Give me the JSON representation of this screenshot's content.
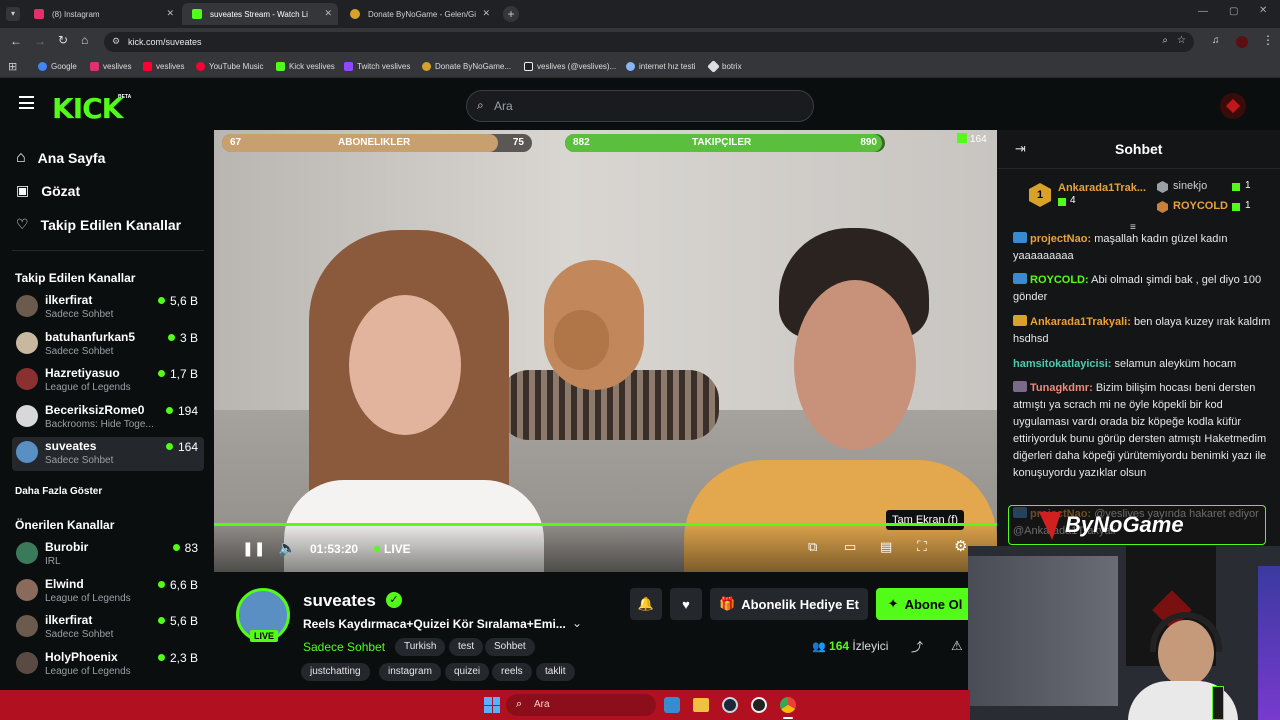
{
  "browser": {
    "tabs": [
      {
        "title": "(8) Instagram",
        "color": "#e1306c"
      },
      {
        "title": "suveates Stream - Watch Li",
        "color": "#53fc18"
      },
      {
        "title": "Donate ByNoGame - Gelen/Gi",
        "color": "#d6a22a"
      }
    ],
    "url": "kick.com/suveates",
    "bookmarks": [
      {
        "label": "Google",
        "color": "#4285f4"
      },
      {
        "label": "veslives",
        "color": "#e1306c"
      },
      {
        "label": "veslives",
        "color": "#ff0033"
      },
      {
        "label": "YouTube Music",
        "color": "#ff0033"
      },
      {
        "label": "Kick veslives",
        "color": "#53fc18"
      },
      {
        "label": "Twitch veslives",
        "color": "#9146ff"
      },
      {
        "label": "Donate ByNoGame...",
        "color": "#d6a22a"
      },
      {
        "label": "veslives (@veslives)...",
        "color": "#ffffff"
      },
      {
        "label": "internet hız testi",
        "color": "#8ab4f8"
      },
      {
        "label": "botrix",
        "color": "#dddddd"
      }
    ]
  },
  "kick": {
    "logo": "KICK",
    "beta": "BETA",
    "search_placeholder": "Ara"
  },
  "nav": {
    "home": "Ana Sayfa",
    "browse": "Gözat",
    "following": "Takip Edilen Kanallar"
  },
  "followed": {
    "heading": "Takip Edilen Kanallar",
    "channels": [
      {
        "name": "ilkerfirat",
        "sub": "Sadece Sohbet",
        "viewers": "5,6 B",
        "color": "#6b5a4e"
      },
      {
        "name": "batuhanfurkan5",
        "sub": "Sadece Sohbet",
        "viewers": "3 B",
        "color": "#c9b8a0"
      },
      {
        "name": "Hazretiyasuo",
        "sub": "League of Legends",
        "viewers": "1,7 B",
        "color": "#8a3030"
      },
      {
        "name": "BeceriksizRome0",
        "sub": "Backrooms: Hide Toge...",
        "viewers": "194",
        "color": "#d8d8d8"
      },
      {
        "name": "suveates",
        "sub": "Sadece Sohbet",
        "viewers": "164",
        "color": "#5a8fc4"
      }
    ],
    "more": "Daha Fazla Göster"
  },
  "recommended": {
    "heading": "Önerilen Kanallar",
    "channels": [
      {
        "name": "Burobir",
        "sub": "IRL",
        "viewers": "83",
        "color": "#3a7a5a"
      },
      {
        "name": "Elwind",
        "sub": "League of Legends",
        "viewers": "6,6 B",
        "color": "#8a6a5a"
      },
      {
        "name": "ilkerfirat",
        "sub": "Sadece Sohbet",
        "viewers": "5,6 B",
        "color": "#6b5a4e"
      },
      {
        "name": "HolyPhoenix",
        "sub": "League of Legends",
        "viewers": "2,3 B",
        "color": "#5a4a44"
      }
    ]
  },
  "video": {
    "goal_subs": {
      "label": "ABONELIKLER",
      "current": "67",
      "target": "75",
      "progress": 0.89
    },
    "goal_followers": {
      "label": "TAKIPÇILER",
      "current": "882",
      "target": "890",
      "progress": 0.99
    },
    "viewer_badge": "164",
    "time": "01:53:20",
    "live": "LIVE",
    "tooltip": "Tam Ekran (f)"
  },
  "stream": {
    "channel": "suveates",
    "title": "Reels Kaydırmaca+Quizei Kör Sıralama+Emi...",
    "category": "Sadece Sohbet",
    "tags": [
      "Turkish",
      "test",
      "Sohbet"
    ],
    "tags2": [
      "justchatting",
      "instagram",
      "quizei",
      "reels",
      "taklit"
    ],
    "live_badge": "LIVE",
    "gift_button": "Abonelik Hediye Et",
    "subscribe_button": "Abone Ol",
    "viewers_count": "164",
    "viewers_label": "İzleyici"
  },
  "chat": {
    "title": "Sohbet",
    "top_gifter": {
      "name": "Ankarada1Trak...",
      "count": "4",
      "rank": "1"
    },
    "gifters": [
      {
        "name": "sinekjo",
        "count": "1",
        "color": "#cfcfcf"
      },
      {
        "name": "ROYCOLD",
        "count": "1",
        "color": "#e8a23c"
      }
    ],
    "messages": [
      {
        "user": "projectNao:",
        "text": "maşallah kadın güzel kadın yaaaaaaaaa",
        "color": "#e8a23c"
      },
      {
        "user": "ROYCOLD:",
        "text": "Abi olmadı şimdi bak , gel diyo 100 gönder",
        "color": "#53fc18"
      },
      {
        "user": "Ankarada1Trakyali:",
        "text": "ben olaya kuzey ırak kaldım hsdhsd",
        "color": "#e8a23c"
      },
      {
        "user": "hamsitokatlayicisi:",
        "text": "selamun aleyküm hocam",
        "color": "#4ec9b0"
      },
      {
        "user": "Tunagkdmr:",
        "text": "Bizim bilişim hocası beni dersten atmıştı ya scrach mi ne öyle köpekli bir kod uygulaması vardı orada biz köpeğe kodla küfür ettiriyorduk bunu görüp dersten atmıştı Haketmedim diğerleri daha köpeği yürütemiyordu benimki yazı ile konuşuyordu yazıklar olsun",
        "color": "#f08a7a"
      },
      {
        "user": "projectNao:",
        "text": "@veslives yayında hakaret ediyor @Ankarada1Trakyali",
        "color": "#e8a23c"
      }
    ],
    "overlay_logo": "ByNoGame"
  },
  "taskbar": {
    "search": "Ara"
  }
}
